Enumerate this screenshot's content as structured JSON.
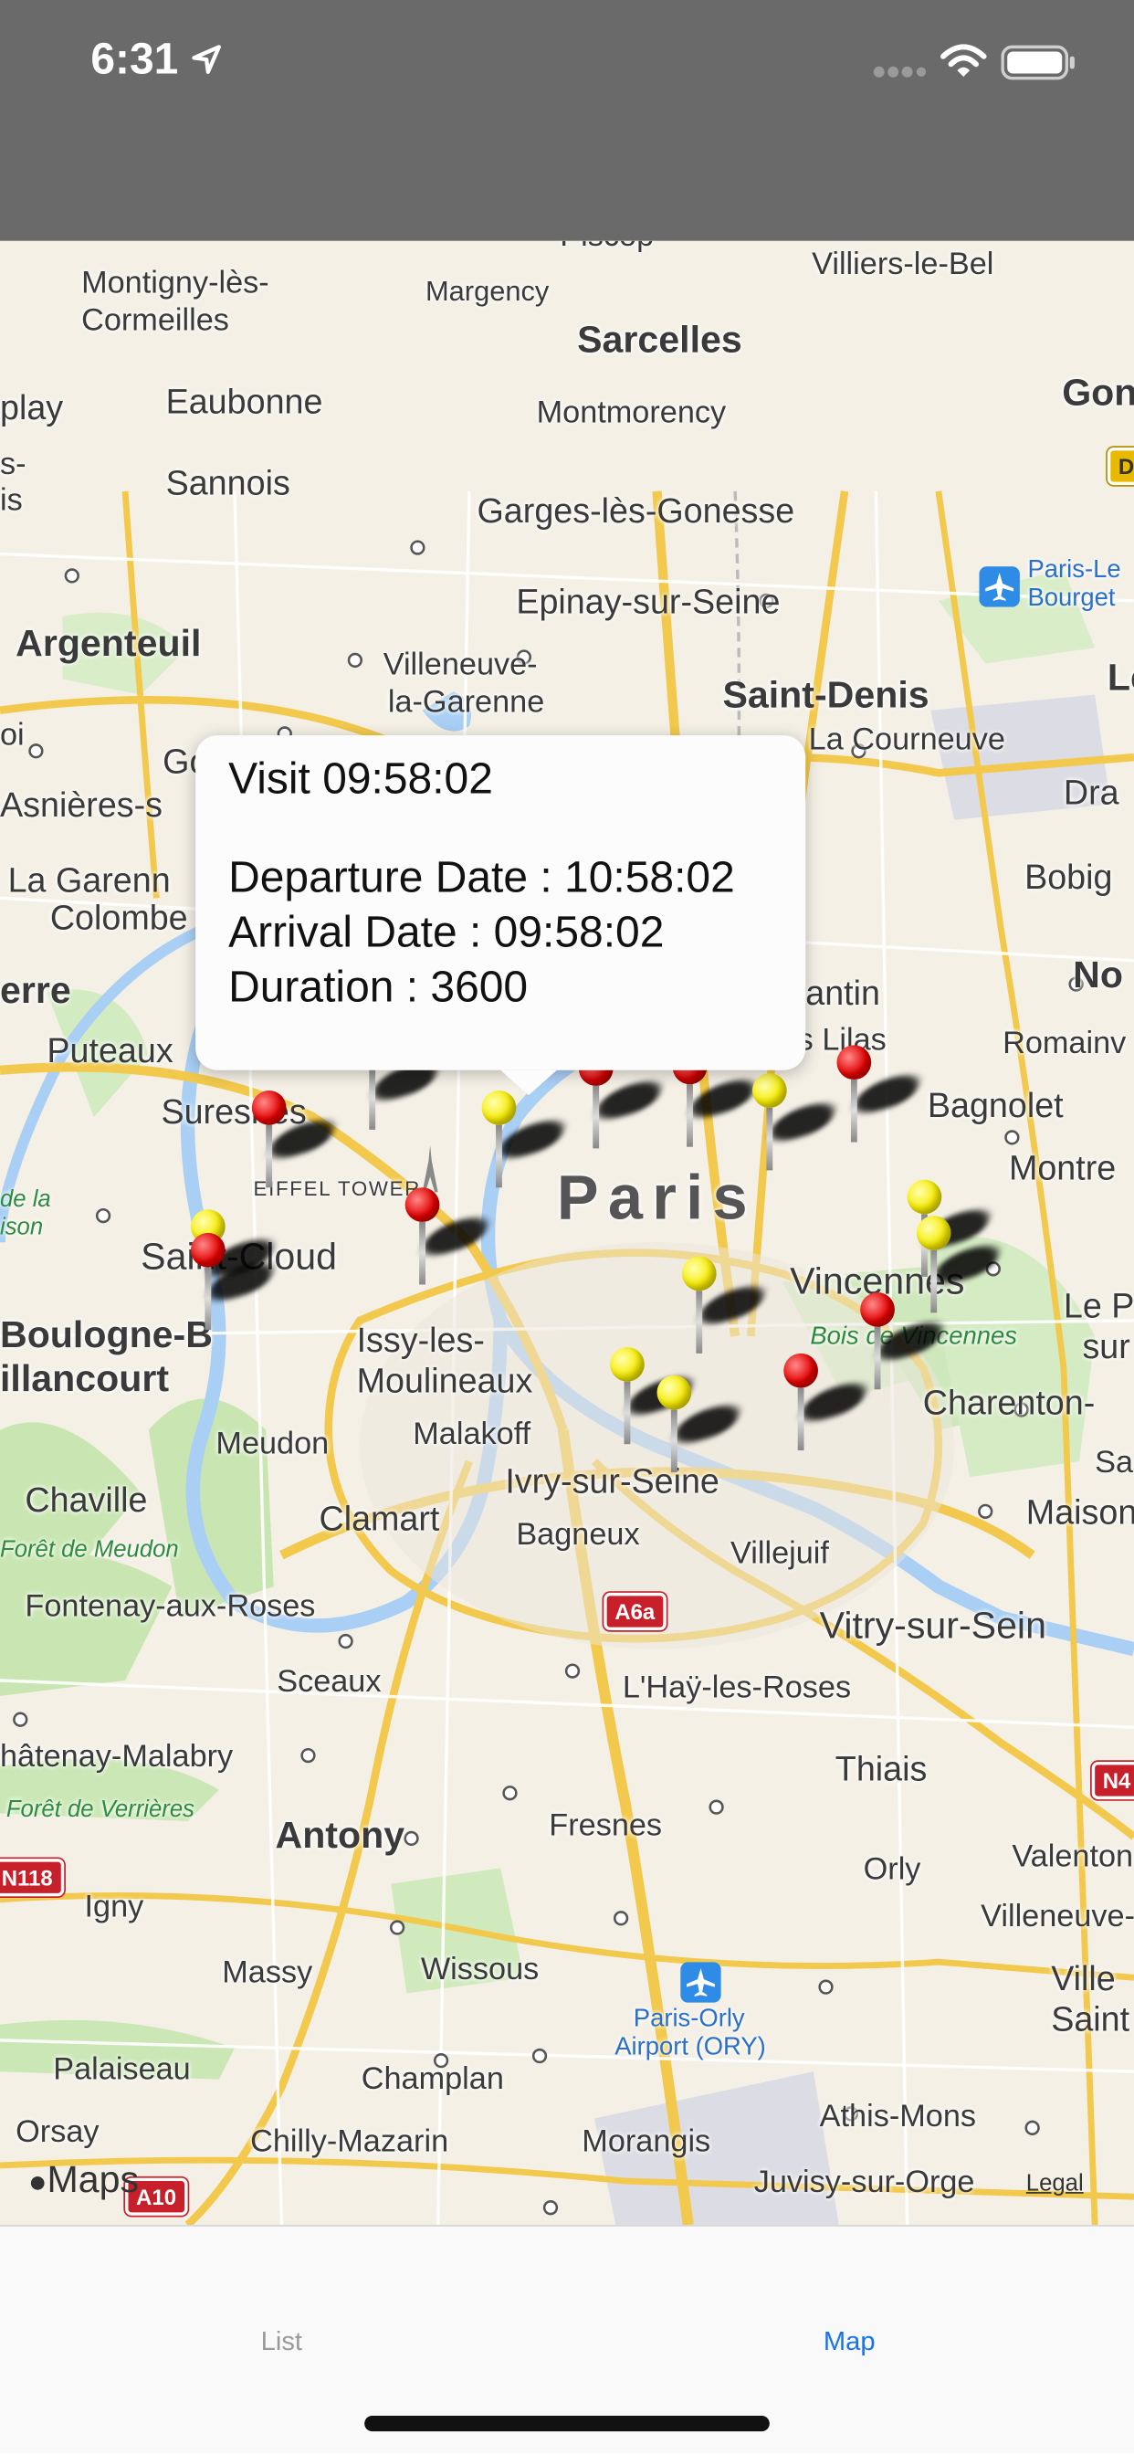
{
  "status_bar": {
    "time": "6:31"
  },
  "map": {
    "labels": {
      "piscop": "Piscop",
      "villiers": "Villiers-le-Bel",
      "montigny": "Montigny-lès-",
      "cormeilles": "Cormeilles",
      "margency": "Margency",
      "sarcelles": "Sarcelles",
      "gon": "Gon",
      "eaubonne": "Eaubonne",
      "montmorency": "Montmorency",
      "play": "play",
      "s": "s-",
      "is": "is",
      "sannois": "Sannois",
      "garges": "Garges-lès-Gonesse",
      "paris_le": "Paris-Le",
      "bourget": "Bourget",
      "argenteuil": "Argenteuil",
      "epinay": "Epinay-sur-Seine",
      "le": "Le",
      "villeneuve": "Villeneuve-",
      "la_garenne": "la-Garenne",
      "saint_denis": "Saint-Denis",
      "oi": "oi",
      "go": "Go",
      "la_courneuve": "La Courneuve",
      "asnieres": "Asnières-s",
      "dra": "Dra",
      "la_garenn": "La Garenn",
      "colombe": "Colombe",
      "bobig": "Bobig",
      "erre": "erre",
      "antin": "antin",
      "no": "No",
      "puteaux": "Puteaux",
      "lilas": "s Lilas",
      "romain": "Romainv",
      "suresnes": "Suresnes",
      "bagnolet": "Bagnolet",
      "eiffel": "EIFFEL TOWER",
      "paris": "Paris",
      "montre": "Montre",
      "de_la": "de la",
      "ison": "ison",
      "saint_cloud": "Saint-Cloud",
      "vincennes": "Vincennes",
      "le_p": "Le P",
      "bois_vincennes": "Bois de Vincennes",
      "sur": "sur",
      "boulogne": "Boulogne-B",
      "billancourt": "illancourt",
      "issy": "Issy-les-",
      "moulineaux": "Moulineaux",
      "charenton": "Charenton-",
      "malakoff": "Malakoff",
      "meudon": "Meudon",
      "ivry": "Ivry-sur-Seine",
      "sa": "Sa",
      "chaville": "Chaville",
      "clamart": "Clamart",
      "bagneux": "Bagneux",
      "maisons": "Maisons",
      "foret_meudon": "Forêt de Meudon",
      "villejuif": "Villejuif",
      "fontenay": "Fontenay-aux-Roses",
      "vitry": "Vitry-sur-Sein",
      "sceaux": "Sceaux",
      "lhay": "L'Haÿ-les-Roses",
      "chatenay": "hâtenay-Malabry",
      "thiais": "Thiais",
      "foret_verrieres": "Forêt de Verrières",
      "antony": "Antony",
      "fresnes": "Fresnes",
      "valenton": "Valenton",
      "orly": "Orly",
      "igny": "Igny",
      "villeneuve_s": "Villeneuve-",
      "massy": "Massy",
      "wissous": "Wissous",
      "ville": "Ville",
      "saint": "Saint",
      "orly_airport1": "Paris-Orly",
      "orly_airport2": "Airport (ORY)",
      "palaiseau": "Palaiseau",
      "champlan": "Champlan",
      "athis": "Athis-Mons",
      "orsay": "Orsay",
      "chilly": "Chilly-Mazarin",
      "morangis": "Morangis",
      "juvisy": "Juvisy-sur-Orge"
    },
    "shields": {
      "a6a": "A6a",
      "n118": "N118",
      "n4": "N4",
      "a10": "A10",
      "d": "D"
    },
    "callout": {
      "title": "Visit 09:58:02",
      "departure": "Departure Date : 10:58:02",
      "arrival": "Arrival Date : 09:58:02",
      "duration": "Duration : 3600"
    },
    "attribution": "Maps",
    "legal": "Legal"
  },
  "tab_bar": {
    "list_label": "List",
    "map_label": "Map",
    "selected": "Map",
    "accent": "#1a73e8"
  }
}
